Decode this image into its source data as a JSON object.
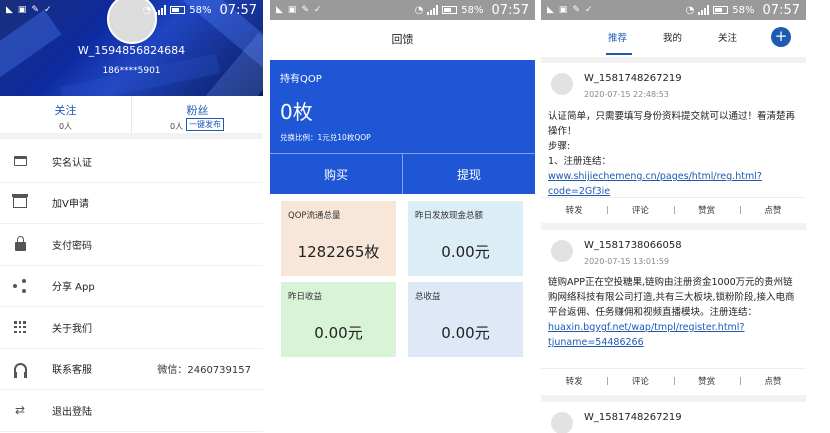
{
  "status_bar": {
    "p1": {
      "battery": "58%",
      "time": "07:57"
    },
    "p2": {
      "battery": "58%",
      "time": "07:57"
    },
    "p3": {
      "battery": "58%",
      "time": "07:57"
    }
  },
  "profile": {
    "username": "W_1594856824684",
    "phone": "186****5901",
    "follow_label": "关注",
    "follow_count": "0人",
    "fans_label": "粉丝",
    "fans_count": "0人",
    "publish_button": "一键发布"
  },
  "menu": [
    {
      "label": "实名认证",
      "icon": "id-card-icon",
      "value": ""
    },
    {
      "label": "加V申请",
      "icon": "gift-icon",
      "value": ""
    },
    {
      "label": "支付密码",
      "icon": "lock-icon",
      "value": ""
    },
    {
      "label": "分享 App",
      "icon": "share-icon",
      "value": ""
    },
    {
      "label": "关于我们",
      "icon": "grid-icon",
      "value": ""
    },
    {
      "label": "联系客服",
      "icon": "headset-icon",
      "value": "微信：2460739157"
    },
    {
      "label": "退出登陆",
      "icon": "exit-icon",
      "value": ""
    }
  ],
  "wallet": {
    "title": "回馈",
    "holding_label": "持有QOP",
    "holding_amount": "0枚",
    "rate": "兑换比例：1元兑10枚QOP",
    "buy_button": "购买",
    "withdraw_button": "提现",
    "stats": [
      {
        "label": "QOP流通总量",
        "value": "1282265枚"
      },
      {
        "label": "昨日发放现金总额",
        "value": "0.00元"
      },
      {
        "label": "昨日收益",
        "value": "0.00元"
      },
      {
        "label": "总收益",
        "value": "0.00元"
      }
    ]
  },
  "feed": {
    "tabs": [
      "推荐",
      "我的",
      "关注"
    ],
    "plus_label": "+",
    "actions": [
      "转发",
      "评论",
      "赞赏",
      "点赞"
    ],
    "posts": [
      {
        "user": "W_1581748267219",
        "time": "2020-07-15 22:48:53",
        "text": "认证简单，只需要填写身份资料提交就可以通过！看清楚再操作！\n步骤:\n1、注册连结：",
        "link": "www.shijiechemeng.cn/pages/html/reg.html?code=2Gf3ie"
      },
      {
        "user": "W_1581738066058",
        "time": "2020-07-15 13:01:59",
        "text": "链购APP正在空投糖果,链购由注册资金1000万元的贵州链购网络科技有限公司打造,共有三大板块,锁粉阶段,接入电商平台返佣、任务赚佣和视频直播模块。注册连结：",
        "link": "huaxin.bgygf.net/wap/tmpl/register.html?tjuname=54486266"
      },
      {
        "user": "W_1581748267219",
        "time": "",
        "text": "",
        "link": ""
      }
    ]
  },
  "colors": {
    "brand_blue": "#1e56d6",
    "link_blue": "#1e5ab4"
  }
}
